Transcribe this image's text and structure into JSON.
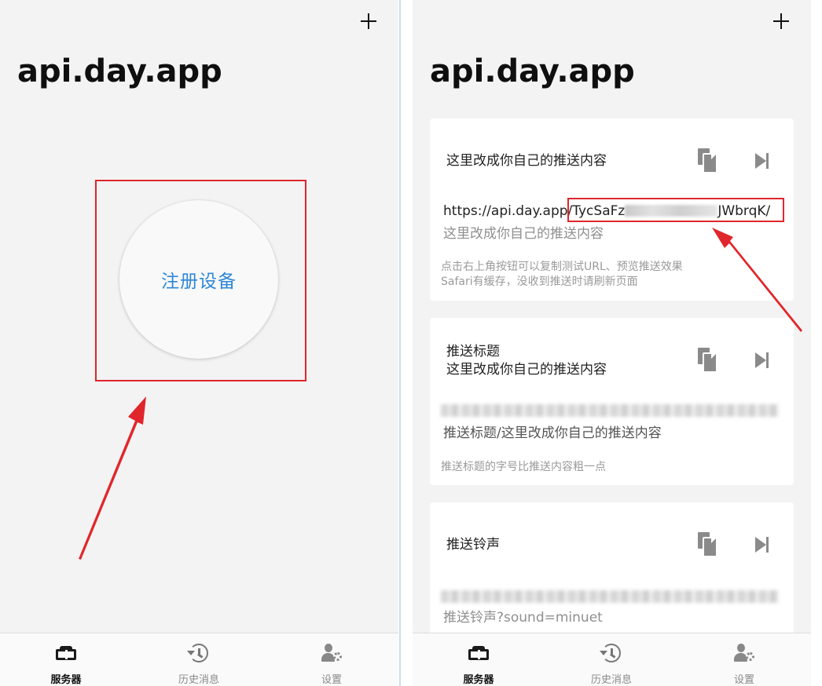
{
  "left": {
    "title": "api.day.app",
    "register_button": "注册设备"
  },
  "right": {
    "title": "api.day.app",
    "cards": [
      {
        "title": "这里改成你自己的推送内容",
        "url_prefix": "https://api.day.app",
        "url_key_start": "/TycSaFz",
        "url_key_end": "JWbrqK/",
        "url_sub": "这里改成你自己的推送内容",
        "note_line1": "点击右上角按钮可以复制测试URL、预览推送效果",
        "note_line2": "Safari有缓存，没收到推送时请刷新页面"
      },
      {
        "title_line1": "推送标题",
        "title_line2": "这里改成你自己的推送内容",
        "url_sub": "推送标题/这里改成你自己的推送内容",
        "note": "推送标题的字号比推送内容粗一点"
      },
      {
        "title": "推送铃声",
        "url_sub": "推送铃声?sound=minuet"
      }
    ]
  },
  "tabs": {
    "server": "服务器",
    "history": "历史消息",
    "settings": "设置"
  },
  "colors": {
    "accent": "#2f87d6",
    "annotation_red": "#e0262b",
    "background": "#f3f3f3"
  },
  "icons": [
    "plus-icon",
    "copy-icon",
    "play-next-icon",
    "server-icon",
    "history-icon",
    "settings-icon"
  ]
}
